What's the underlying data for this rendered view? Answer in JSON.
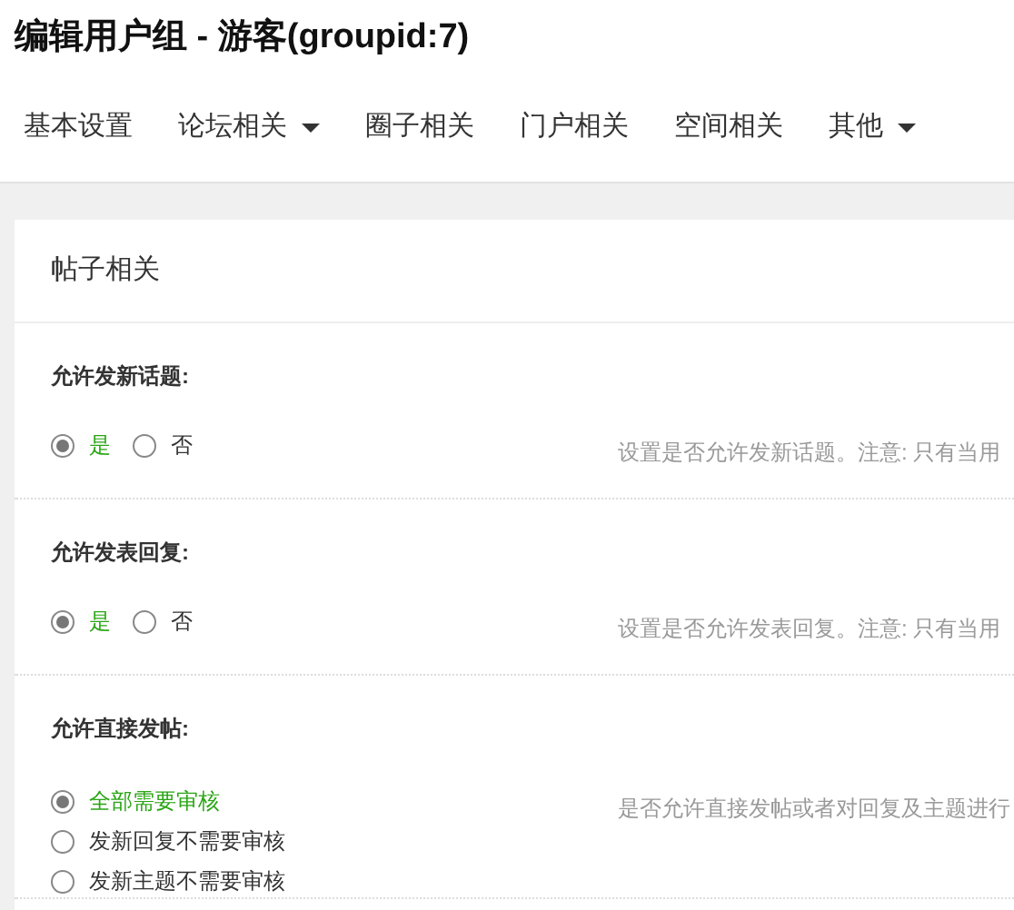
{
  "page_title": "编辑用户组 - 游客(groupid:7)",
  "tabs": [
    {
      "label": "基本设置",
      "dropdown": false
    },
    {
      "label": "论坛相关",
      "dropdown": true
    },
    {
      "label": "圈子相关",
      "dropdown": false
    },
    {
      "label": "门户相关",
      "dropdown": false
    },
    {
      "label": "空间相关",
      "dropdown": false
    },
    {
      "label": "其他",
      "dropdown": true
    }
  ],
  "card": {
    "title": "帖子相关",
    "settings": [
      {
        "label": "允许发新话题:",
        "kind": "inline",
        "description": "设置是否允许发新话题。注意: 只有当用",
        "options": [
          {
            "label": "是",
            "selected": true
          },
          {
            "label": "否",
            "selected": false
          }
        ]
      },
      {
        "label": "允许发表回复:",
        "kind": "inline",
        "description": "设置是否允许发表回复。注意: 只有当用",
        "options": [
          {
            "label": "是",
            "selected": true
          },
          {
            "label": "否",
            "selected": false
          }
        ]
      },
      {
        "label": "允许直接发帖:",
        "kind": "stacked",
        "description": "是否允许直接发帖或者对回复及主题进行",
        "options": [
          {
            "label": "全部需要审核",
            "selected": true
          },
          {
            "label": "发新回复不需要审核",
            "selected": false
          },
          {
            "label": "发新主题不需要审核",
            "selected": false
          }
        ]
      }
    ]
  }
}
